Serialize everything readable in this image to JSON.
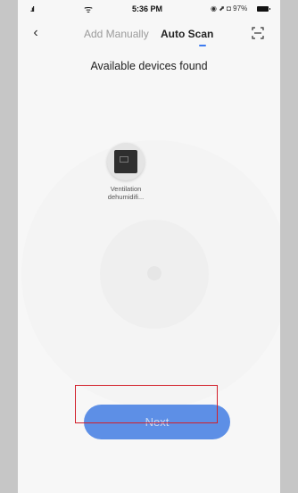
{
  "status_bar": {
    "signal": ".ıl",
    "wifi": "ᯤ",
    "time": "5:36 PM",
    "right": "◉ ⬈ ◘ 97%"
  },
  "nav": {
    "back": "‹",
    "tabs": [
      {
        "label": "Add Manually",
        "active": false
      },
      {
        "label": "Auto Scan",
        "active": true
      }
    ]
  },
  "heading": "Available devices found",
  "devices": [
    {
      "label": "Ventilation dehumidifi..."
    }
  ],
  "next_button": "Next",
  "colors": {
    "accent": "#3d7bf0",
    "button": "#5d8fe6",
    "highlight": "#d21f2a"
  }
}
